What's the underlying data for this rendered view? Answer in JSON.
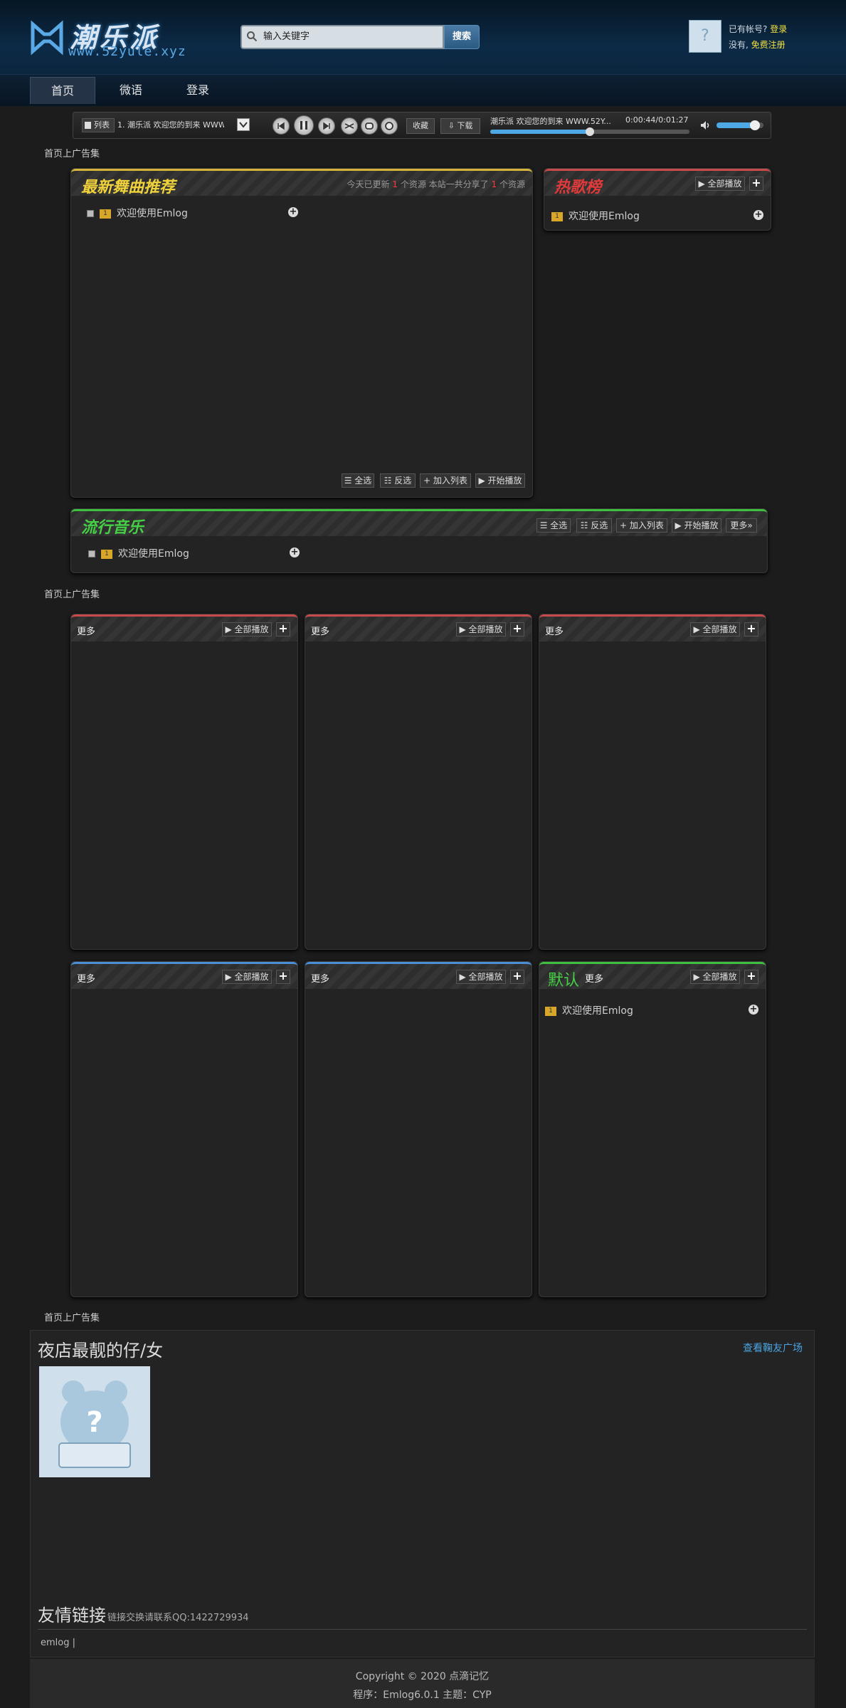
{
  "header": {
    "site_name": "潮乐派",
    "site_url": "www.52yule.xyz",
    "search_placeholder": "输入关键字",
    "search_button": "搜索",
    "have_account": "已有帐号?",
    "login": "登录",
    "no_account": "没有,",
    "register": "免费注册"
  },
  "nav": [
    "首页",
    "微语",
    "登录"
  ],
  "player": {
    "list_label": "列表",
    "current_song": "1. 潮乐派 欢迎您的到来 WWW.",
    "collect": "收藏",
    "download": "下载",
    "now_playing": "潮乐派 欢迎您的到来 WWW.52Y...",
    "time": "0:00:44/0:01:27",
    "progress": 0.5,
    "volume": 0.82
  },
  "ad_label": "首页上广告集",
  "latest": {
    "title": "最新舞曲推荐",
    "info_prefix": "今天已更新",
    "today_count": "1",
    "info_mid": "个资源 本站一共分享了",
    "total_count": "1",
    "info_suffix": "个资源",
    "item": "欢迎使用Emlog",
    "badge": "1"
  },
  "hot": {
    "title": "热歌榜",
    "play_all": "全部播放",
    "item": "欢迎使用Emlog",
    "badge": "1"
  },
  "toolbar": {
    "select_all": "全选",
    "invert": "反选",
    "add_list": "加入列表",
    "start_play": "开始播放",
    "more": "更多»"
  },
  "popular": {
    "title": "流行音乐",
    "item": "欢迎使用Emlog"
  },
  "grid": {
    "more": "更多",
    "play_all": "全部播放",
    "default_title": "默认",
    "default_item": "欢迎使用Emlog",
    "badge": "1"
  },
  "footer": {
    "gallery_title": "夜店最靓的仔/女",
    "gallery_link": "查看鞠友广场",
    "friends_title": "友情链接",
    "friends_note": "链接交换请联系QQ:1422729934",
    "friend_item": "emlog |",
    "copyright": "Copyright © 2020 点滴记忆",
    "powered": "程序：Emlog6.0.1 主题：CYP"
  },
  "colors": {
    "accent_blue": "#4fa8e6",
    "yellow": "#f0e040",
    "red_border": "#c94a4a",
    "blue_border": "#4a8fd6",
    "green_border": "#3fbf3f",
    "gold_border": "#d6b43c"
  }
}
